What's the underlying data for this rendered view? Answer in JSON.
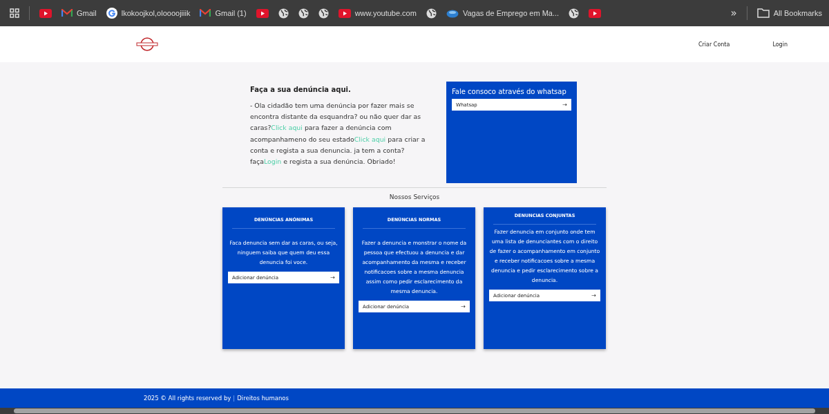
{
  "bookmarks_bar": {
    "items": [
      {
        "kind": "youtube"
      },
      {
        "kind": "gmail",
        "label": "Gmail"
      },
      {
        "kind": "google",
        "label": "lkokoojkol,oloooojiiik"
      },
      {
        "kind": "gmail",
        "label": "Gmail (1)"
      },
      {
        "kind": "youtube"
      },
      {
        "kind": "globe"
      },
      {
        "kind": "globe"
      },
      {
        "kind": "globe"
      },
      {
        "kind": "youtube",
        "label": "www.youtube.com"
      },
      {
        "kind": "globe"
      },
      {
        "kind": "site",
        "label": "Vagas de Emprego em Ma..."
      },
      {
        "kind": "globe"
      },
      {
        "kind": "youtube"
      }
    ],
    "more": "»",
    "all_bookmarks": "All Bookmarks"
  },
  "nav": {
    "links": [
      "Criar Conta",
      "Login"
    ]
  },
  "intro": {
    "title": "Faça a sua denúncia aqui.",
    "paragraph": [
      {
        "kind": "text",
        "text": "- Ola cidadão tem uma denúncia por fazer mais se encontra distante da esquandra? ou não quer dar as caras?"
      },
      {
        "kind": "link",
        "text": "Click aqui"
      },
      {
        "kind": "text",
        "text": " para fazer a denúncia com acompanhameno do seu estado"
      },
      {
        "kind": "link",
        "text": "Click aqui"
      },
      {
        "kind": "text",
        "text": " para criar a conta e regista a sua denuncia. ja tem a conta? faça"
      },
      {
        "kind": "link",
        "text": "Login"
      },
      {
        "kind": "text",
        "text": " e regista a sua denúncia. Obriado!"
      }
    ]
  },
  "whatsapp": {
    "title": "Fale consoco através do whatsap",
    "field": "Whatsap",
    "arrow": "→"
  },
  "services": {
    "title": "Nossos Serviços",
    "cards": [
      {
        "title": "DENÚNCIAS ANÓNIMAS",
        "text": "Faca denuncia sem dar as caras, ou seja, ninguem saiba que quem deu essa denuncia foi voce.",
        "button": "Adicionar denúncia",
        "arrow": "→"
      },
      {
        "title": "DENÚNCIAS NORMAS",
        "text": "Fazer a denuncia e monstrar o nome da pessoa que efectuou a denuncia e dar acompanhamento da mesma e receber notificacoes sobre a mesma denuncia assim como pedir esclarecimento da mesma denuncia.",
        "button": "Adicionar denúncia",
        "arrow": "→"
      },
      {
        "title": "DENUNCIAS CONJUNTAS",
        "text": "Fazer denuncia em conjunto onde tem uma lista de denunciantes com o direito de fazer o acompanhamento em conjunto e receber notificacoes sobre a mesma denuncia e pedir esclarecimento sobre a denuncia.",
        "button": "Adicionar denúncia",
        "arrow": "→"
      }
    ]
  },
  "footer": {
    "text": "2025 © All rights reserved by",
    "separator": "|",
    "link": "Direitos humanos"
  }
}
